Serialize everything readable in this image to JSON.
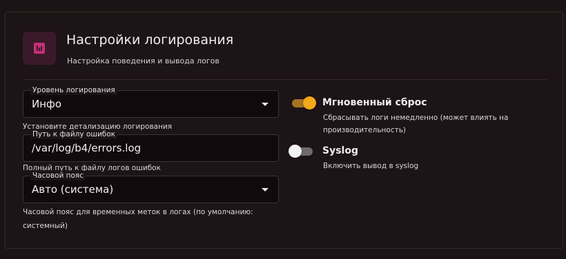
{
  "section": {
    "title": "Настройки логирования",
    "subtitle": "Настройка поведения и вывода логов",
    "icon": "bar-chart-icon",
    "icon_color": "#e0408a"
  },
  "fields": {
    "log_level": {
      "label": "Уровень логирования",
      "value": "Инфо",
      "helper": "Установите детализацию логирования"
    },
    "error_log_path": {
      "label": "Путь к файлу ошибок",
      "value": "/var/log/b4/errors.log",
      "helper": "Полный путь к файлу логов ошибок"
    },
    "timezone": {
      "label": "Часовой пояс",
      "value": "Авто (система)",
      "helper_line1": "Часовой пояс для временных меток в логах (по умолчанию:",
      "helper_line2": "системный)"
    }
  },
  "switches": {
    "instant_flush": {
      "title": "Мгновенный сброс",
      "enabled": true,
      "desc_line1": "Сбрасывать логи немедленно (может влиять на",
      "desc_line2": "производительность)"
    },
    "syslog": {
      "title": "Syslog",
      "enabled": false,
      "desc": "Включить вывод в syslog"
    }
  },
  "colors": {
    "accent": "#f4a81c",
    "background": "#1c1416",
    "border": "#3a2a22"
  }
}
